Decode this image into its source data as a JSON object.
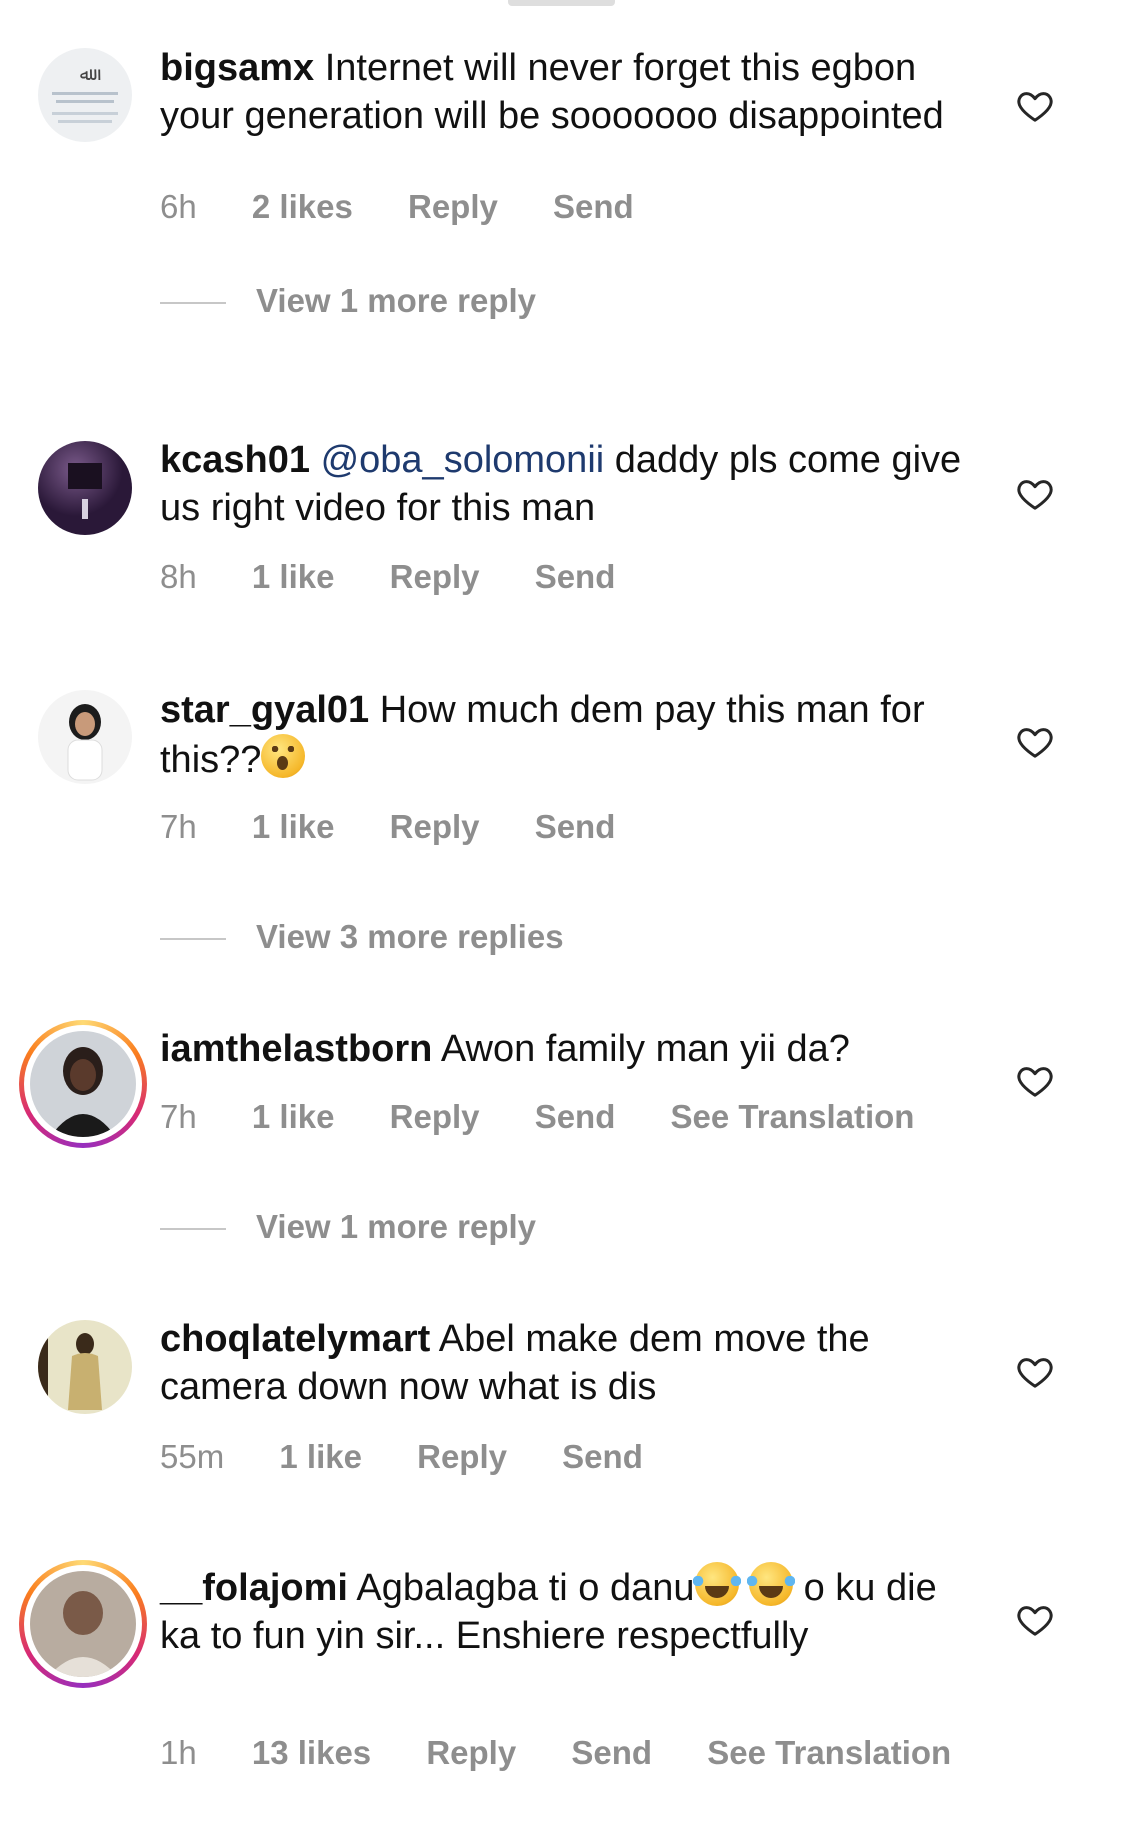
{
  "comments": [
    {
      "username": "bigsamx",
      "text": "Internet will never forget this egbon your generation will be sooooooo disappointed",
      "time": "6h",
      "likes": "2 likes",
      "reply": "Reply",
      "send": "Send",
      "view_more": "View 1 more reply"
    },
    {
      "username": "kcash01",
      "mention": "@oba_solomonii",
      "text": " daddy pls come give us right video for this man",
      "time": "8h",
      "likes": "1 like",
      "reply": "Reply",
      "send": "Send"
    },
    {
      "username": "star_gyal01",
      "text": "How much dem pay this man for this??",
      "emoji": "astonished-face-emoji",
      "time": "7h",
      "likes": "1 like",
      "reply": "Reply",
      "send": "Send",
      "view_more": "View 3 more replies"
    },
    {
      "username": "iamthelastborn",
      "text": "Awon family man yii da?",
      "time": "7h",
      "likes": "1 like",
      "reply": "Reply",
      "send": "Send",
      "translate": "See Translation",
      "view_more": "View 1 more reply"
    },
    {
      "username": "choqlatelymart",
      "text": "Abel make dem move the camera down now what is dis",
      "time": "55m",
      "likes": "1 like",
      "reply": "Reply",
      "send": "Send"
    },
    {
      "username": "__folajomi",
      "text_part1": "Agbalagba ti o danu",
      "text_part2": " o ku die ka to fun yin sir... Enshiere respectfully",
      "emoji": "tears-of-joy-emoji",
      "time": "1h",
      "likes": "13 likes",
      "reply": "Reply",
      "send": "Send",
      "translate": "See Translation"
    }
  ],
  "colors": {
    "meta_gray": "#8e8e8e",
    "mention_blue": "#1e3a6e",
    "story_ring": [
      "#feda75",
      "#fa7e1e",
      "#d62976",
      "#962fbf"
    ]
  }
}
